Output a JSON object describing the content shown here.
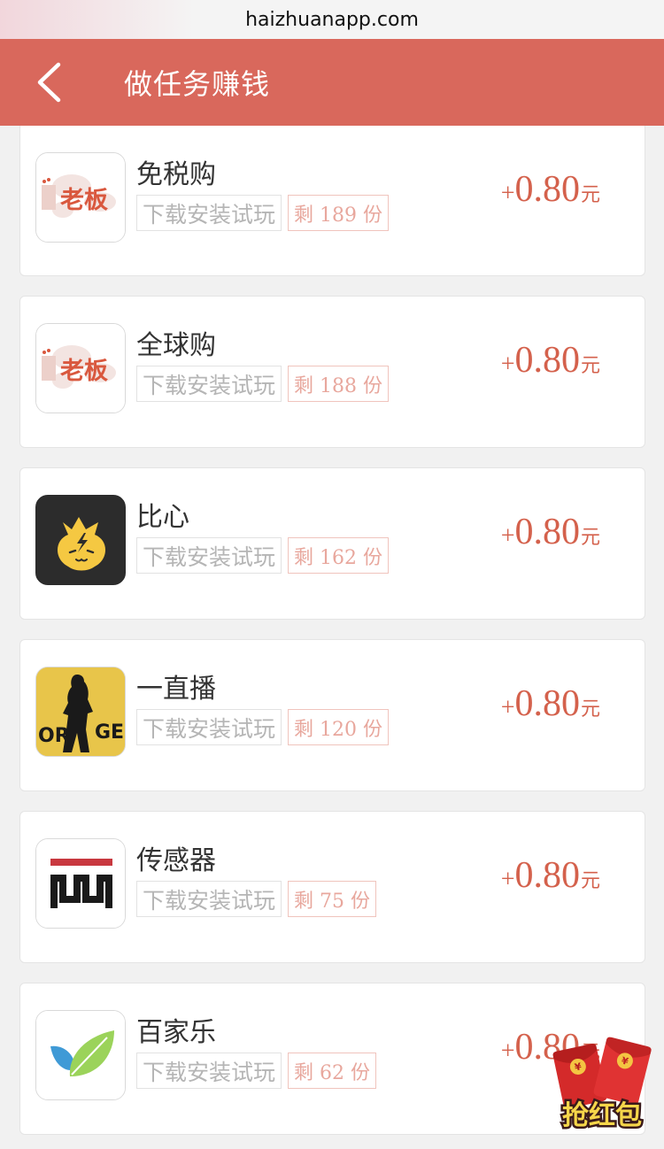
{
  "browser": {
    "url": "haizhuanapp.com"
  },
  "header": {
    "title": "做任务赚钱"
  },
  "tasks": [
    {
      "name": "免税购",
      "tag": "下载安装试玩",
      "remain": "剩 189 份",
      "plus": "+",
      "amount": "0.80",
      "unit": "元",
      "icon": "laoban-logo-icon"
    },
    {
      "name": "全球购",
      "tag": "下载安装试玩",
      "remain": "剩 188 份",
      "plus": "+",
      "amount": "0.80",
      "unit": "元",
      "icon": "laoban-logo-icon"
    },
    {
      "name": "比心",
      "tag": "下载安装试玩",
      "remain": "剩 162 份",
      "plus": "+",
      "amount": "0.80",
      "unit": "元",
      "icon": "bixin-logo-icon"
    },
    {
      "name": "一直播",
      "tag": "下载安装试玩",
      "remain": "剩 120 份",
      "plus": "+",
      "amount": "0.80",
      "unit": "元",
      "icon": "orange-logo-icon"
    },
    {
      "name": "传感器",
      "tag": "下载安装试玩",
      "remain": "剩 75 份",
      "plus": "+",
      "amount": "0.80",
      "unit": "元",
      "icon": "sensor-logo-icon"
    },
    {
      "name": "百家乐",
      "tag": "下载安装试玩",
      "remain": "剩 62 份",
      "plus": "+",
      "amount": "0.80",
      "unit": "元",
      "icon": "leaf-logo-icon"
    }
  ],
  "icon_text": {
    "laoban": "老板",
    "orange_left": "OR",
    "orange_right": "GE"
  },
  "red_packet": {
    "label": "抢红包",
    "icon": "red-packet-icon"
  },
  "colors": {
    "header": "#d9685c",
    "reward": "#d4614c",
    "tag_remain": "#e8a79d"
  }
}
